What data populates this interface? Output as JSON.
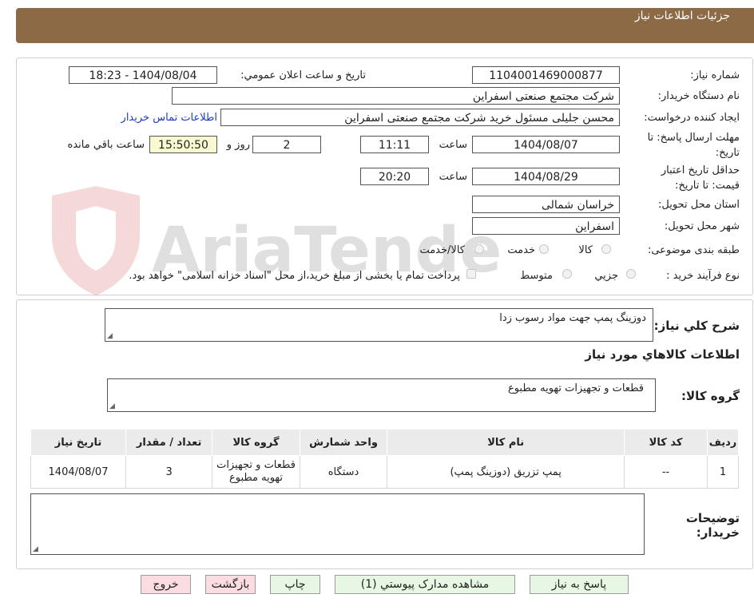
{
  "header": {
    "title": "جزئیات اطلاعات نیاز"
  },
  "form": {
    "need_number_label": "شماره نیاز:",
    "need_number": "1104001469000877",
    "announce_label": "تاریخ و ساعت اعلان عمومي:",
    "announce_value": "1404/08/04 - 18:23",
    "buyer_org_label": "نام دستگاه خریدار:",
    "buyer_org": "شرکت مجتمع صنعتی اسفراین",
    "creator_label": "ایجاد کننده درخواست:",
    "creator": "محسن جلیلی مسئول خرید شرکت مجتمع صنعتی اسفراین",
    "contact_link": "اطلاعات تماس خریدار",
    "deadline_label_1": "مهلت ارسال پاسخ: تا",
    "deadline_label_2": "تاریخ:",
    "deadline_date": "1404/08/07",
    "time_label": "ساعت",
    "deadline_time": "11:11",
    "days_value": "2",
    "days_label": "روز و",
    "remaining_time": "15:50:50",
    "remaining_label": "ساعت باقي مانده",
    "validity_label_1": "حداقل تاریخ اعتبار",
    "validity_label_2": "قیمت: تا تاریخ:",
    "validity_date": "1404/08/29",
    "validity_time": "20:20",
    "province_label": "استان محل تحویل:",
    "province": "خراسان شمالی",
    "city_label": "شهر محل تحویل:",
    "city": "اسفراین",
    "category_label": "طبقه بندی موضوعی:",
    "category_options": [
      "کالا",
      "خدمت",
      "کالا/خدمت"
    ],
    "process_label": "نوع فرآیند خرید :",
    "process_options": [
      "جزیي",
      "متوسط"
    ],
    "payment_note": "پرداخت تمام یا بخشی از مبلغ خرید،از محل \"اسناد خزانه اسلامی\" خواهد بود."
  },
  "watermark_text": "AriaTender.neT",
  "details": {
    "summary_label": "شرح کلي نیاز:",
    "summary": "دوزینگ پمپ جهت مواد رسوب زدا",
    "goods_info_title": "اطلاعات کالاهاي مورد نیاز",
    "goods_group_label": "گروه کالا:",
    "goods_group": "قطعات و تجهیزات تهویه مطبوع",
    "table": {
      "headers": [
        "ردیف",
        "کد کالا",
        "نام کالا",
        "واحد شمارش",
        "گروه کالا",
        "تعداد / مقدار",
        "تاریخ نیاز"
      ],
      "rows": [
        [
          "1",
          "--",
          "پمپ تزریق (دوزینگ پمپ)",
          "دستگاه",
          "قطعات و تجهیزات تهویه مطبوع",
          "3",
          "1404/08/07"
        ]
      ]
    },
    "buyer_notes_label_1": "توضیحات",
    "buyer_notes_label_2": "خریدار:"
  },
  "buttons": {
    "reply": "پاسخ به نیاز",
    "attachments": "مشاهده مدارک پیوستي (1)",
    "print": "چاپ",
    "back": "بازگشت",
    "exit": "خروج"
  }
}
